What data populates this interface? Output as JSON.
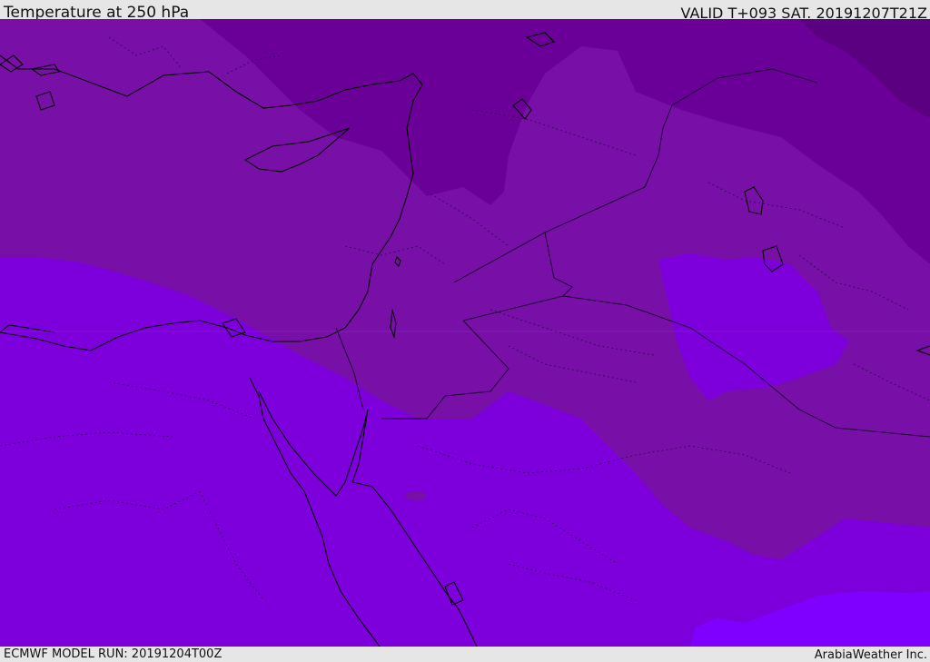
{
  "header": {
    "title": "Temperature at 250 hPa",
    "valid": "VALID T+093 SAT. 20191207T21Z"
  },
  "footer": {
    "model_run": "ECMWF MODEL RUN: 20191204T00Z",
    "credit": "ArabiaWeather Inc."
  },
  "map": {
    "region": "Eastern Mediterranean / Middle East",
    "colors": {
      "deep_violet": "#5a0080",
      "dark_purple": "#6a0098",
      "purple": "#7810a8",
      "violet": "#7d00dc",
      "bright_violet": "#7f00ff",
      "coast_line": "#000000",
      "border_line": "#1a0030"
    }
  }
}
